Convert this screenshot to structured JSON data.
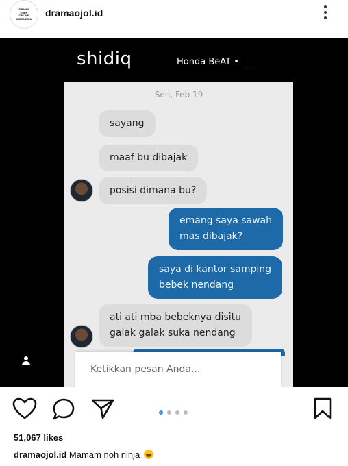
{
  "header": {
    "avatar_text": "DRAMA OJEK ONLINE INDONESIA",
    "username": "dramaojol.id",
    "menu_icon": "kebab-menu-icon"
  },
  "post_image": {
    "contact_name": "shidiq",
    "vehicle": "Honda BeAT • _ _",
    "date": "Sen, Feb 19",
    "messages": [
      {
        "from": "driver",
        "text": "sayang"
      },
      {
        "from": "driver",
        "text": "maaf bu dibajak"
      },
      {
        "from": "driver",
        "text": "posisi dimana bu?"
      },
      {
        "from": "user",
        "text": "emang saya sawah\nmas dibajak?"
      },
      {
        "from": "user",
        "text": "saya di kantor samping\nbebek nendang"
      },
      {
        "from": "driver",
        "text": "ati ati mba bebeknya disitu\ngalak galak suka nendang"
      }
    ],
    "input_placeholder": "Ketikkan pesan Anda..."
  },
  "actions": {
    "like_icon": "heart-icon",
    "comment_icon": "comment-icon",
    "share_icon": "send-icon",
    "save_icon": "bookmark-icon",
    "carousel_count": 4,
    "carousel_active": 1
  },
  "likes": "51,067 likes",
  "caption": {
    "username": "dramaojol.id",
    "text": "Mamam noh ninja",
    "emoji": "laughing-emoji"
  },
  "colors": {
    "outgoing_bubble": "#1e6aa8",
    "incoming_bubble": "#dcdcdc",
    "chat_background": "#ebebeb",
    "carousel_active": "#3897f0"
  }
}
